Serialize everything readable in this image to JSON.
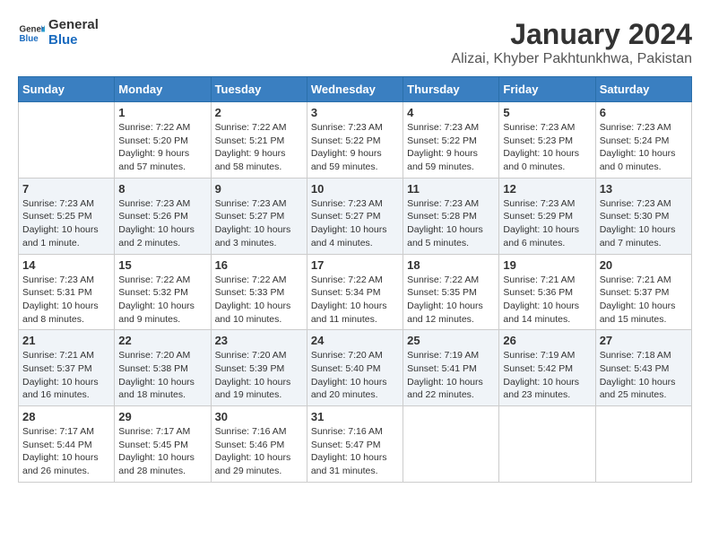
{
  "logo": {
    "general": "General",
    "blue": "Blue"
  },
  "title": "January 2024",
  "subtitle": "Alizai, Khyber Pakhtunkhwa, Pakistan",
  "days_of_week": [
    "Sunday",
    "Monday",
    "Tuesday",
    "Wednesday",
    "Thursday",
    "Friday",
    "Saturday"
  ],
  "weeks": [
    [
      {
        "day": "",
        "sunrise": "",
        "sunset": "",
        "daylight": ""
      },
      {
        "day": "1",
        "sunrise": "Sunrise: 7:22 AM",
        "sunset": "Sunset: 5:20 PM",
        "daylight": "Daylight: 9 hours and 57 minutes."
      },
      {
        "day": "2",
        "sunrise": "Sunrise: 7:22 AM",
        "sunset": "Sunset: 5:21 PM",
        "daylight": "Daylight: 9 hours and 58 minutes."
      },
      {
        "day": "3",
        "sunrise": "Sunrise: 7:23 AM",
        "sunset": "Sunset: 5:22 PM",
        "daylight": "Daylight: 9 hours and 59 minutes."
      },
      {
        "day": "4",
        "sunrise": "Sunrise: 7:23 AM",
        "sunset": "Sunset: 5:22 PM",
        "daylight": "Daylight: 9 hours and 59 minutes."
      },
      {
        "day": "5",
        "sunrise": "Sunrise: 7:23 AM",
        "sunset": "Sunset: 5:23 PM",
        "daylight": "Daylight: 10 hours and 0 minutes."
      },
      {
        "day": "6",
        "sunrise": "Sunrise: 7:23 AM",
        "sunset": "Sunset: 5:24 PM",
        "daylight": "Daylight: 10 hours and 0 minutes."
      }
    ],
    [
      {
        "day": "7",
        "sunrise": "Sunrise: 7:23 AM",
        "sunset": "Sunset: 5:25 PM",
        "daylight": "Daylight: 10 hours and 1 minute."
      },
      {
        "day": "8",
        "sunrise": "Sunrise: 7:23 AM",
        "sunset": "Sunset: 5:26 PM",
        "daylight": "Daylight: 10 hours and 2 minutes."
      },
      {
        "day": "9",
        "sunrise": "Sunrise: 7:23 AM",
        "sunset": "Sunset: 5:27 PM",
        "daylight": "Daylight: 10 hours and 3 minutes."
      },
      {
        "day": "10",
        "sunrise": "Sunrise: 7:23 AM",
        "sunset": "Sunset: 5:27 PM",
        "daylight": "Daylight: 10 hours and 4 minutes."
      },
      {
        "day": "11",
        "sunrise": "Sunrise: 7:23 AM",
        "sunset": "Sunset: 5:28 PM",
        "daylight": "Daylight: 10 hours and 5 minutes."
      },
      {
        "day": "12",
        "sunrise": "Sunrise: 7:23 AM",
        "sunset": "Sunset: 5:29 PM",
        "daylight": "Daylight: 10 hours and 6 minutes."
      },
      {
        "day": "13",
        "sunrise": "Sunrise: 7:23 AM",
        "sunset": "Sunset: 5:30 PM",
        "daylight": "Daylight: 10 hours and 7 minutes."
      }
    ],
    [
      {
        "day": "14",
        "sunrise": "Sunrise: 7:23 AM",
        "sunset": "Sunset: 5:31 PM",
        "daylight": "Daylight: 10 hours and 8 minutes."
      },
      {
        "day": "15",
        "sunrise": "Sunrise: 7:22 AM",
        "sunset": "Sunset: 5:32 PM",
        "daylight": "Daylight: 10 hours and 9 minutes."
      },
      {
        "day": "16",
        "sunrise": "Sunrise: 7:22 AM",
        "sunset": "Sunset: 5:33 PM",
        "daylight": "Daylight: 10 hours and 10 minutes."
      },
      {
        "day": "17",
        "sunrise": "Sunrise: 7:22 AM",
        "sunset": "Sunset: 5:34 PM",
        "daylight": "Daylight: 10 hours and 11 minutes."
      },
      {
        "day": "18",
        "sunrise": "Sunrise: 7:22 AM",
        "sunset": "Sunset: 5:35 PM",
        "daylight": "Daylight: 10 hours and 12 minutes."
      },
      {
        "day": "19",
        "sunrise": "Sunrise: 7:21 AM",
        "sunset": "Sunset: 5:36 PM",
        "daylight": "Daylight: 10 hours and 14 minutes."
      },
      {
        "day": "20",
        "sunrise": "Sunrise: 7:21 AM",
        "sunset": "Sunset: 5:37 PM",
        "daylight": "Daylight: 10 hours and 15 minutes."
      }
    ],
    [
      {
        "day": "21",
        "sunrise": "Sunrise: 7:21 AM",
        "sunset": "Sunset: 5:37 PM",
        "daylight": "Daylight: 10 hours and 16 minutes."
      },
      {
        "day": "22",
        "sunrise": "Sunrise: 7:20 AM",
        "sunset": "Sunset: 5:38 PM",
        "daylight": "Daylight: 10 hours and 18 minutes."
      },
      {
        "day": "23",
        "sunrise": "Sunrise: 7:20 AM",
        "sunset": "Sunset: 5:39 PM",
        "daylight": "Daylight: 10 hours and 19 minutes."
      },
      {
        "day": "24",
        "sunrise": "Sunrise: 7:20 AM",
        "sunset": "Sunset: 5:40 PM",
        "daylight": "Daylight: 10 hours and 20 minutes."
      },
      {
        "day": "25",
        "sunrise": "Sunrise: 7:19 AM",
        "sunset": "Sunset: 5:41 PM",
        "daylight": "Daylight: 10 hours and 22 minutes."
      },
      {
        "day": "26",
        "sunrise": "Sunrise: 7:19 AM",
        "sunset": "Sunset: 5:42 PM",
        "daylight": "Daylight: 10 hours and 23 minutes."
      },
      {
        "day": "27",
        "sunrise": "Sunrise: 7:18 AM",
        "sunset": "Sunset: 5:43 PM",
        "daylight": "Daylight: 10 hours and 25 minutes."
      }
    ],
    [
      {
        "day": "28",
        "sunrise": "Sunrise: 7:17 AM",
        "sunset": "Sunset: 5:44 PM",
        "daylight": "Daylight: 10 hours and 26 minutes."
      },
      {
        "day": "29",
        "sunrise": "Sunrise: 7:17 AM",
        "sunset": "Sunset: 5:45 PM",
        "daylight": "Daylight: 10 hours and 28 minutes."
      },
      {
        "day": "30",
        "sunrise": "Sunrise: 7:16 AM",
        "sunset": "Sunset: 5:46 PM",
        "daylight": "Daylight: 10 hours and 29 minutes."
      },
      {
        "day": "31",
        "sunrise": "Sunrise: 7:16 AM",
        "sunset": "Sunset: 5:47 PM",
        "daylight": "Daylight: 10 hours and 31 minutes."
      },
      {
        "day": "",
        "sunrise": "",
        "sunset": "",
        "daylight": ""
      },
      {
        "day": "",
        "sunrise": "",
        "sunset": "",
        "daylight": ""
      },
      {
        "day": "",
        "sunrise": "",
        "sunset": "",
        "daylight": ""
      }
    ]
  ]
}
